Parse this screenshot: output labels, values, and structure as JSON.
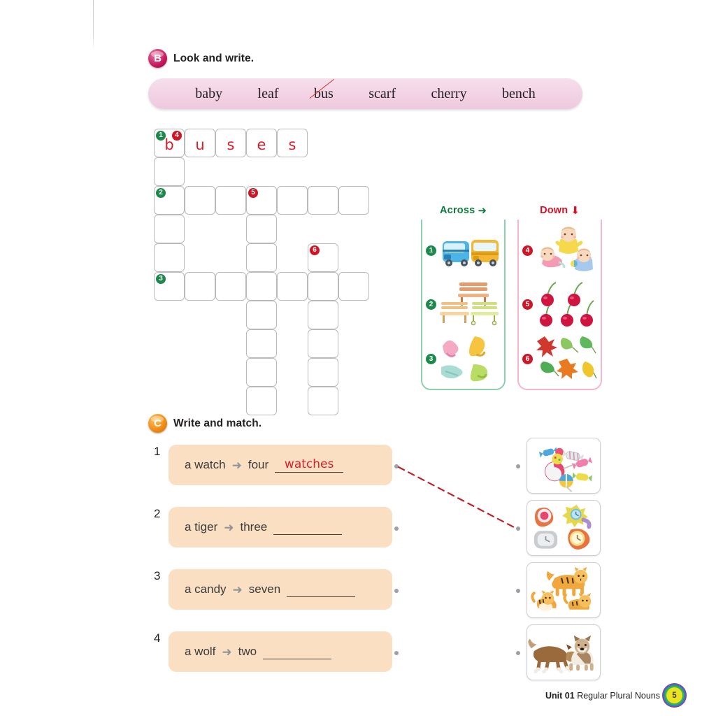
{
  "page": {
    "footer_unit": "Unit 01",
    "footer_topic": "Regular Plural Nouns",
    "page_number": "5"
  },
  "section_b": {
    "badge": "B",
    "title": "Look and write.",
    "word_bank": [
      {
        "word": "baby",
        "struck": false
      },
      {
        "word": "leaf",
        "struck": false
      },
      {
        "word": "bus",
        "struck": true
      },
      {
        "word": "scarf",
        "struck": false
      },
      {
        "word": "cherry",
        "struck": false
      },
      {
        "word": "bench",
        "struck": false
      }
    ],
    "crossword": {
      "filled_answer": "buses",
      "letters": [
        "b",
        "u",
        "s",
        "e",
        "s"
      ],
      "across_label": "Across",
      "across_arrow": "➜",
      "down_label": "Down",
      "down_arrow": "⬇",
      "across_clues": [
        {
          "number": "1",
          "answer": "buses",
          "art": "two-buses"
        },
        {
          "number": "2",
          "answer": "benches",
          "art": "three-benches"
        },
        {
          "number": "3",
          "answer": "scarves",
          "art": "four-scarves"
        }
      ],
      "down_clues": [
        {
          "number": "4",
          "answer": "babies",
          "art": "three-babies"
        },
        {
          "number": "5",
          "answer": "cherries",
          "art": "five-cherries"
        },
        {
          "number": "6",
          "answer": "leaves",
          "art": "six-leaves"
        }
      ]
    }
  },
  "section_c": {
    "badge": "C",
    "title": "Write and match.",
    "arrow": "➜",
    "items": [
      {
        "index": "1",
        "singular": "a watch",
        "count": "four",
        "answer": "watches",
        "match_art": "candies-card"
      },
      {
        "index": "2",
        "singular": "a tiger",
        "count": "three",
        "answer": "",
        "match_art": "watches-card"
      },
      {
        "index": "3",
        "singular": "a candy",
        "count": "seven",
        "answer": "",
        "match_art": "tigers-card"
      },
      {
        "index": "4",
        "singular": "a wolf",
        "count": "two",
        "answer": "",
        "match_art": "wolves-card"
      }
    ],
    "picture_cards": [
      {
        "art": "candies-card"
      },
      {
        "art": "watches-card"
      },
      {
        "art": "tigers-card"
      },
      {
        "art": "wolves-card"
      }
    ],
    "drawn_match": {
      "from_item": "1",
      "to_card": "2",
      "color": "#c0202a"
    }
  }
}
